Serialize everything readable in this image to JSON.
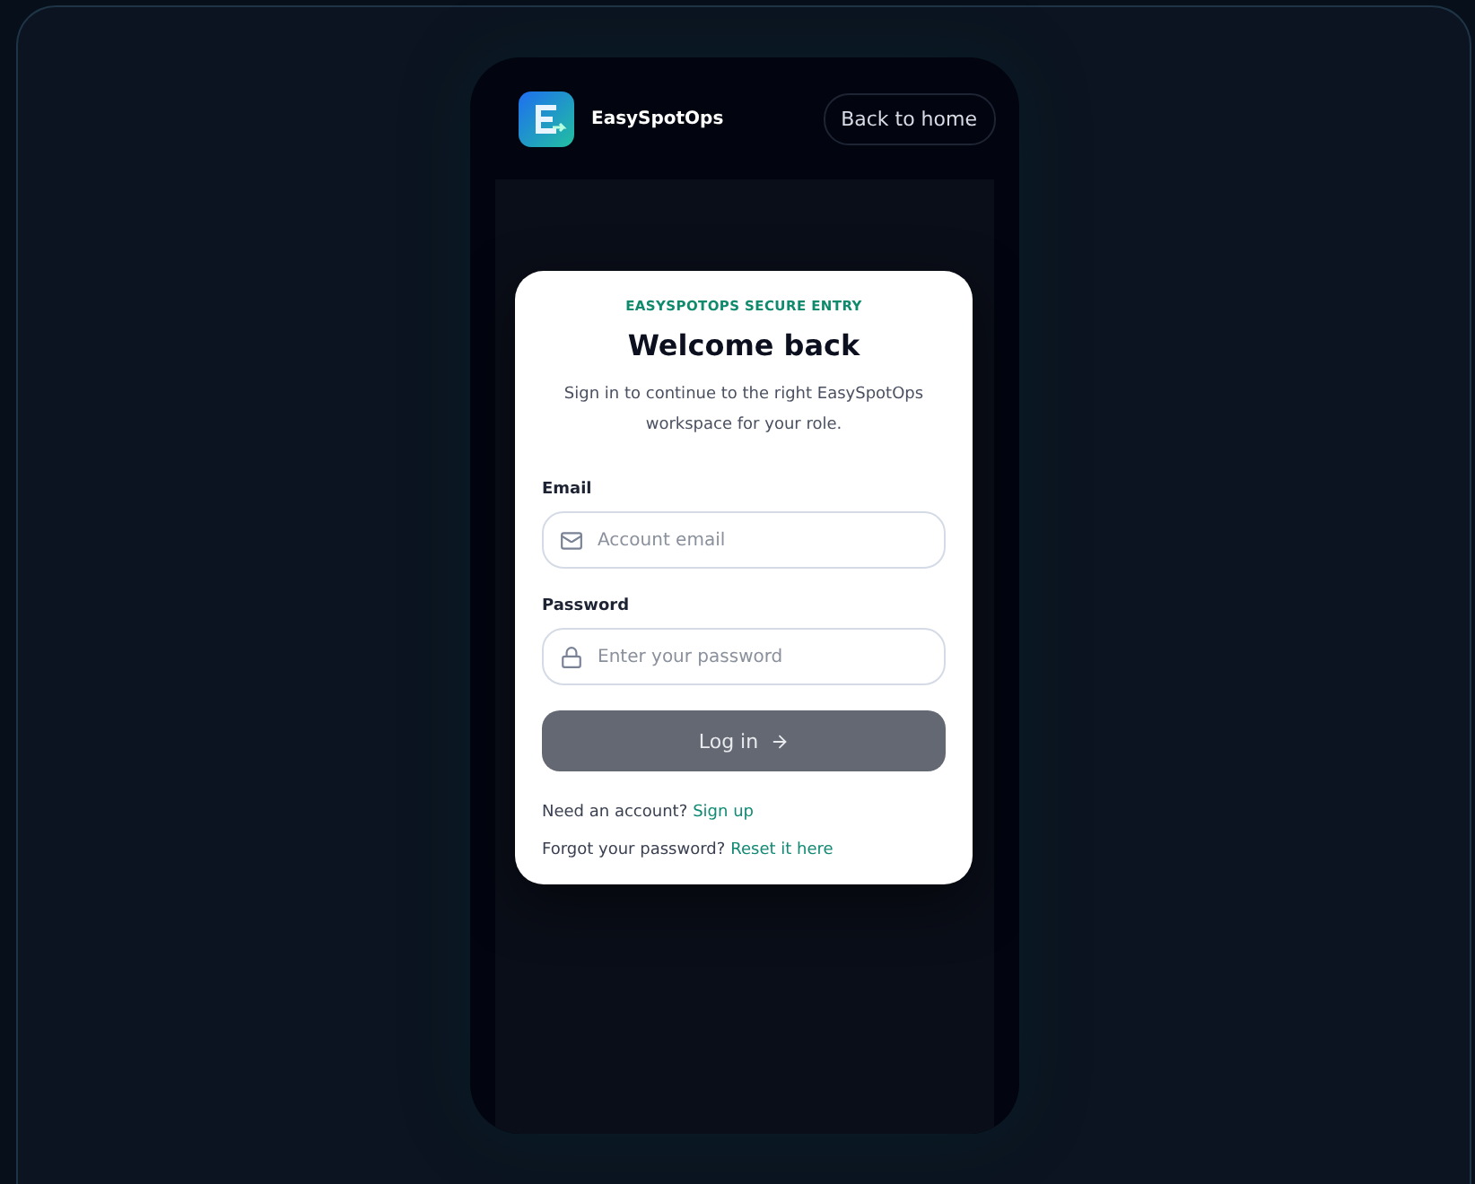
{
  "header": {
    "brand": "EasySpotOps",
    "back_button": "Back to home"
  },
  "card": {
    "eyebrow": "EASYSPOTOPS SECURE ENTRY",
    "title": "Welcome back",
    "subtitle": "Sign in to continue to the right EasySpotOps workspace for your role.",
    "fields": [
      {
        "kind": "email",
        "label": "Email",
        "placeholder": "Account email"
      },
      {
        "kind": "password",
        "label": "Password",
        "placeholder": "Enter your password"
      }
    ],
    "submit": {
      "label": "Log in",
      "disabled": true
    },
    "links": [
      {
        "text": "Need an account?",
        "link": "Sign up"
      },
      {
        "text": "Forgot your password?",
        "link": "Reset it here"
      }
    ]
  }
}
